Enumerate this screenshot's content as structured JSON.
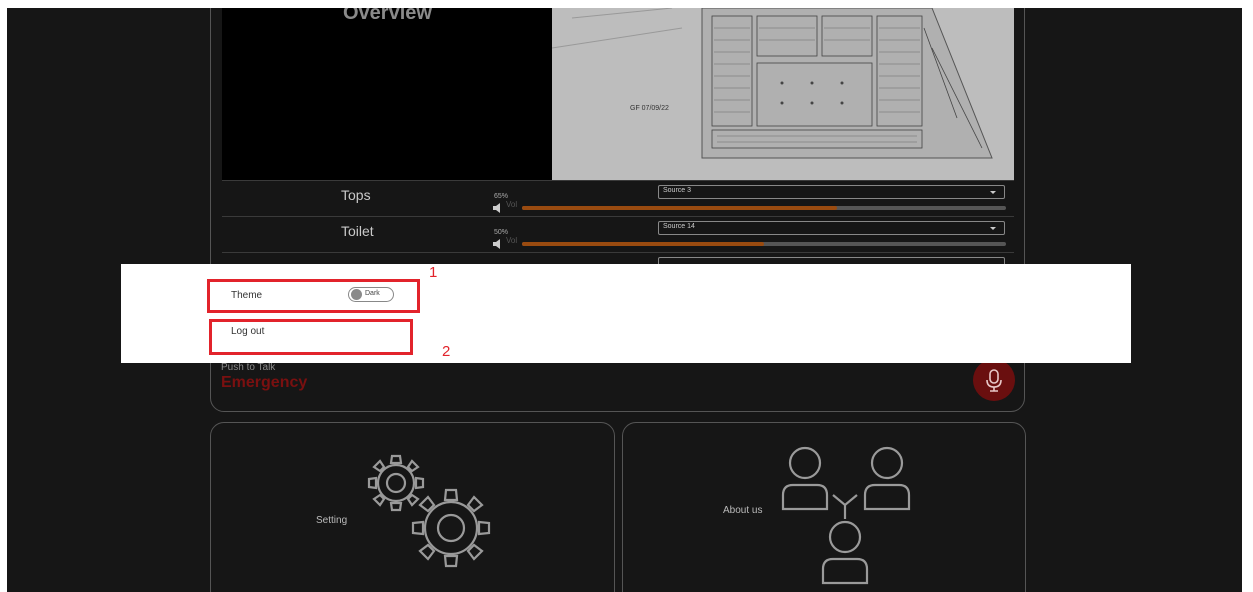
{
  "overview": {
    "title": "Overview"
  },
  "floorplan": {
    "label": "GF 07/09/22"
  },
  "zones": [
    {
      "name": "Tops",
      "volume_percent": 65,
      "volume_text": "65%",
      "vol_label": "Vol",
      "source": "Source 3"
    },
    {
      "name": "Toilet",
      "volume_percent": 50,
      "volume_text": "50%",
      "vol_label": "Vol",
      "source": "Source 14"
    }
  ],
  "push_to_talk": {
    "label": "Push to Talk",
    "value": "Emergency"
  },
  "cards": {
    "setting": "Setting",
    "about": "About us"
  },
  "settings_menu": {
    "theme_label": "Theme",
    "theme_value": "Dark",
    "logout_label": "Log out"
  },
  "annotations": [
    "1",
    "2"
  ],
  "colors": {
    "accent_red": "#e2232b",
    "volume_fill": "#9a4b10",
    "mic_button": "#6a0f0f"
  }
}
